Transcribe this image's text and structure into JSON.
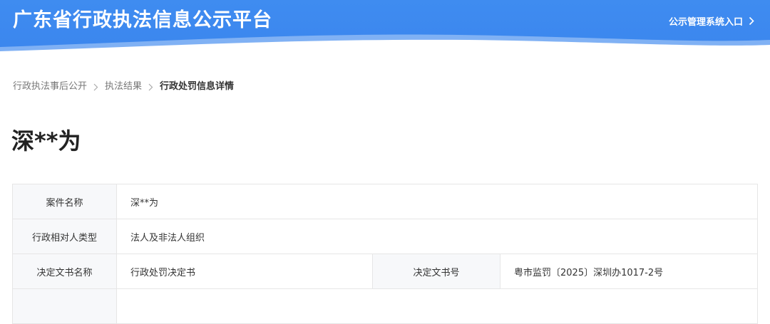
{
  "header": {
    "title": "广东省行政执法信息公示平台",
    "portal_link": "公示管理系统入口",
    "colors": {
      "banner": "#3b86ee",
      "wave": "#ffffff"
    }
  },
  "breadcrumb": {
    "items": [
      "行政执法事后公开",
      "执法结果",
      "行政处罚信息详情"
    ]
  },
  "page": {
    "title": "深**为"
  },
  "details": {
    "case_name_label": "案件名称",
    "case_name_value": "深**为",
    "party_type_label": "行政相对人类型",
    "party_type_value": "法人及非法人组织",
    "doc_name_label": "决定文书名称",
    "doc_name_value": "行政处罚决定书",
    "doc_number_label": "决定文书号",
    "doc_number_value": "粤市监罚〔2025〕深圳办1017-2号"
  }
}
